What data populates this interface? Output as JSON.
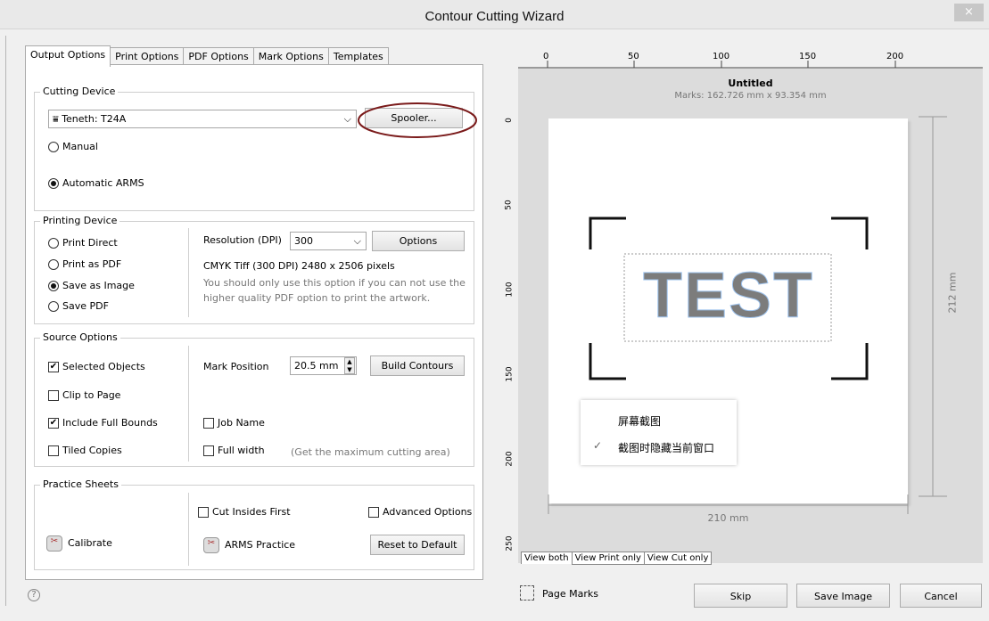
{
  "window": {
    "title": "Contour Cutting Wizard",
    "close_label": "×"
  },
  "tabs": [
    "Output Options",
    "Print Options",
    "PDF Options",
    "Mark Options",
    "Templates"
  ],
  "cutting_device": {
    "title": "Cutting Device",
    "device": "Teneth: T24A",
    "spooler": "Spooler...",
    "manual": "Manual",
    "automatic": "Automatic ARMS"
  },
  "printing_device": {
    "title": "Printing Device",
    "print_direct": "Print Direct",
    "print_pdf": "Print as PDF",
    "save_image": "Save as Image",
    "save_pdf": "Save PDF",
    "resolution_label": "Resolution (DPI)",
    "resolution_value": "300",
    "options": "Options",
    "info": "CMYK Tiff  (300 DPI) 2480 x 2506 pixels",
    "note1": "You should only use this option if you can not use the",
    "note2": "higher quality PDF option to print the artwork."
  },
  "source_options": {
    "title": "Source Options",
    "selected_objects": "Selected Objects",
    "clip_to_page": "Clip to Page",
    "include_full_bounds": "Include Full Bounds",
    "tiled_copies": "Tiled Copies",
    "mark_position_label": "Mark Position",
    "mark_position_value": "20.5 mm",
    "build_contours": "Build Contours",
    "job_name": "Job Name",
    "full_width": "Full width",
    "full_width_note": "(Get the maximum cutting area)"
  },
  "practice_sheets": {
    "title": "Practice Sheets",
    "cut_insides_first": "Cut Insides First",
    "advanced_options": "Advanced Options",
    "calibrate": "Calibrate",
    "arms_practice": "ARMS Practice",
    "reset": "Reset to Default"
  },
  "preview": {
    "ruler_top": [
      "0",
      "50",
      "100",
      "150",
      "200"
    ],
    "ruler_left": [
      "0",
      "50",
      "100",
      "150",
      "200",
      "250"
    ],
    "doc_title": "Untitled",
    "marks_info": "Marks: 162.726 mm x 93.354 mm",
    "artwork_text": "TEST",
    "height_dim": "212 mm",
    "width_dim": "210 mm",
    "context_menu": [
      "屏幕截图",
      "截图时隐藏当前窗口"
    ],
    "view_tabs": [
      "View both",
      "View Print only",
      "View Cut only"
    ]
  },
  "footer": {
    "help": "?",
    "page_marks": "Page Marks",
    "skip": "Skip",
    "save_image": "Save Image",
    "cancel": "Cancel"
  },
  "colors": {
    "highlight_ellipse": "#7a1a1a",
    "artwork_fill": "#7c7c7c",
    "artwork_outline": "#9ec3ee"
  }
}
